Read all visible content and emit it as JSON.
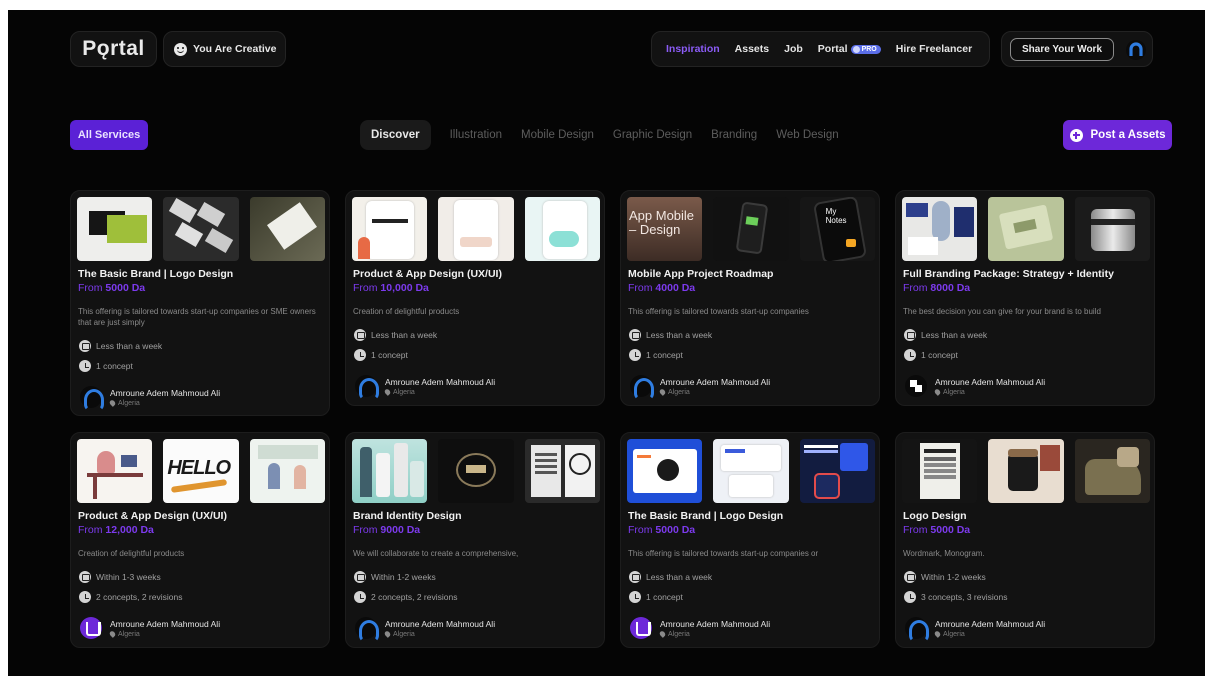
{
  "header": {
    "logo": "Pǫrtal",
    "creative_label": "You Are Creative",
    "nav": [
      {
        "label": "Inspiration",
        "active": true
      },
      {
        "label": "Assets",
        "active": false
      },
      {
        "label": "Job",
        "active": false
      },
      {
        "label": "Portal",
        "active": false,
        "badge": "PRO"
      },
      {
        "label": "Hire Freelancer",
        "active": false
      }
    ],
    "share_label": "Share Your Work"
  },
  "filters": {
    "all_services": "All Services",
    "categories": [
      "Discover",
      "Illustration",
      "Mobile Design",
      "Graphic Design",
      "Branding",
      "Web Design"
    ],
    "active_category": "Discover",
    "post_label": "Post a Assets"
  },
  "colors": {
    "accent": "#7c3aed",
    "background": "#050505",
    "card": "#121212"
  },
  "cards": [
    {
      "title": "The Basic Brand | Logo Design",
      "price_prefix": "From",
      "price": "5000 Da",
      "description": "This offering is tailored towards start-up companies or SME owners that are just simply",
      "delivery": "Less than a week",
      "concepts": "1 concept",
      "author": "Amroune Adem Mahmoud Ali",
      "location": "Algeria",
      "avatar": "blue",
      "thumbs": [
        "green-business-card",
        "pen-stationery",
        "white-envelope"
      ]
    },
    {
      "title": "Product & App Design (UX/UI)",
      "price_prefix": "From",
      "price": "10,000 Da",
      "description": "Creation of delightful products",
      "delivery": "Less than a week",
      "concepts": "1 concept",
      "author": "Amroune Adem Mahmoud Ali",
      "location": "Algeria",
      "avatar": "blue",
      "thumbs": [
        "app-screen-welcome",
        "app-screen-list",
        "app-screen-onboarding"
      ]
    },
    {
      "title": "Mobile App Project Roadmap",
      "price_prefix": "From",
      "price": "4000 Da",
      "description": "This offering is tailored towards start-up companies",
      "delivery": "Less than a week",
      "concepts": "1 concept",
      "author": "Amroune Adem Mahmoud Ali",
      "location": "Algeria",
      "avatar": "blue",
      "thumbs": [
        "app-mobile-design-text",
        "phone-mockup-dark",
        "my-notes-phone"
      ],
      "thumb_text": [
        "App Mobile",
        "Design",
        "My",
        "Notes"
      ]
    },
    {
      "title": "Full Branding Package: Strategy + Identity",
      "price_prefix": "From",
      "price": "8000 Da",
      "description": "The best decision you can give for your brand is to build",
      "delivery": "Less than a week",
      "concepts": "1 concept",
      "author": "Amroune Adem Mahmoud Ali",
      "location": "Algeria",
      "avatar": "bw",
      "thumbs": [
        "brand-stationery-blue",
        "green-packaging",
        "container-jar"
      ]
    },
    {
      "title": "Product & App Design (UX/UI)",
      "price_prefix": "From",
      "price": "12,000 Da",
      "description": "Creation of delightful products",
      "delivery": "Within 1-3 weeks",
      "concepts": "2 concepts, 2 revisions",
      "author": "Amroune Adem Mahmoud Ali",
      "location": "Algeria",
      "avatar": "purple",
      "thumbs": [
        "illustration-desk",
        "hello-lettering",
        "illustration-people"
      ],
      "thumb_text": [
        "HELLO"
      ]
    },
    {
      "title": "Brand Identity Design",
      "price_prefix": "From",
      "price": "9000 Da",
      "description": "We will collaborate to create a comprehensive,",
      "delivery": "Within 1-2 weeks",
      "concepts": "2 concepts, 2 revisions",
      "author": "Amroune Adem Mahmoud Ali",
      "location": "Algeria",
      "avatar": "blue",
      "thumbs": [
        "cosmetic-bottles",
        "dark-logo-emblem",
        "magazine-pages"
      ]
    },
    {
      "title": "The Basic Brand | Logo Design",
      "price_prefix": "From",
      "price": "5000 Da",
      "description": "This offering is tailored towards start-up companies or",
      "delivery": "Less than a week",
      "concepts": "1 concept",
      "author": "Amroune Adem Mahmoud Ali",
      "location": "Algeria",
      "avatar": "purple",
      "thumbs": [
        "blue-web-dashboard",
        "white-ui-cards",
        "tech-presentation-dark"
      ]
    },
    {
      "title": "Logo Design",
      "price_prefix": "From",
      "price": "5000 Da",
      "description": "Wordmark, Monogram.",
      "delivery": "Within 1-2 weeks",
      "concepts": "3 concepts, 3 revisions",
      "author": "Amroune Adem Mahmoud Ali",
      "location": "Algeria",
      "avatar": "blue",
      "thumbs": [
        "newspaper-poster",
        "cosmetic-jar",
        "olive-fabric"
      ]
    }
  ]
}
